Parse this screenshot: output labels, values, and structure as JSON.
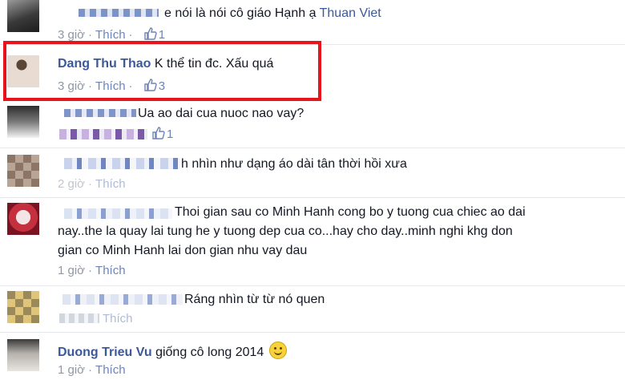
{
  "comments": [
    {
      "text_tail": "e nói là nói cô giáo Hạnh ạ",
      "mention": "Thuan Viet",
      "time": "3 giờ",
      "like": "Thích",
      "likes": "1"
    },
    {
      "author": "Dang Thu Thao",
      "text": "K thể tin đc. Xấu quá",
      "time": "3 giờ",
      "like": "Thích",
      "likes": "3"
    },
    {
      "text_tail": "Ua ao dai cua nuoc nao vay?",
      "likes": "1"
    },
    {
      "text_tail": "h nhìn như dạng áo dài tân thời hồi xưa",
      "time": "2 giờ",
      "like": "Thích"
    },
    {
      "text_line1": "Thoi gian sau co Minh Hanh cong bo y tuong cua chiec ao dai",
      "text_line2": "nay..the la quay lai tung he y tuong dep cua co...hay cho day..minh nghi khg don",
      "text_line3": "gian co Minh Hanh lai don gian nhu vay dau",
      "time": "1 giờ",
      "like": "Thích"
    },
    {
      "text_tail": "Ráng nhìn từ từ nó quen",
      "like": "Thích"
    },
    {
      "author": "Duong Trieu Vu",
      "text": "giống cô long 2014",
      "time": "1 giờ",
      "like": "Thích"
    }
  ],
  "colors": {
    "link": "#3b5998",
    "meta": "#9197a3",
    "highlight": "#e8141b"
  },
  "icons": {
    "like": "thumbs-up-icon",
    "emoji": "smiley-emoji-icon"
  }
}
